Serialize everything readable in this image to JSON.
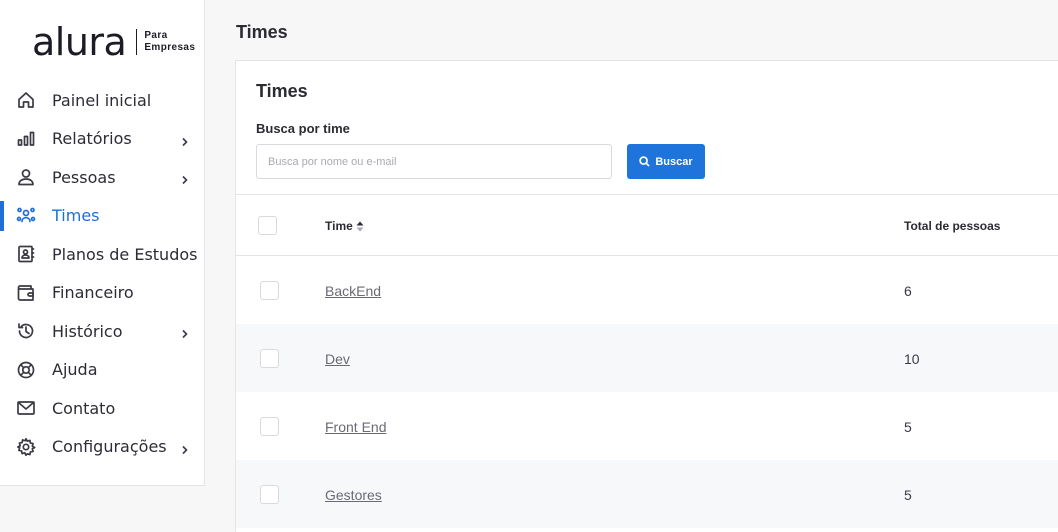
{
  "brand": {
    "logo_text": "alura",
    "sub_line1": "Para",
    "sub_line2": "Empresas"
  },
  "nav": [
    {
      "label": "Painel inicial",
      "icon": "home-icon",
      "chevron": false,
      "active": false
    },
    {
      "label": "Relatórios",
      "icon": "bar-chart-icon",
      "chevron": true,
      "active": false
    },
    {
      "label": "Pessoas",
      "icon": "person-icon",
      "chevron": true,
      "active": false
    },
    {
      "label": "Times",
      "icon": "team-icon",
      "chevron": false,
      "active": true
    },
    {
      "label": "Planos de Estudos",
      "icon": "study-plan-icon",
      "chevron": false,
      "active": false
    },
    {
      "label": "Financeiro",
      "icon": "wallet-icon",
      "chevron": false,
      "active": false
    },
    {
      "label": "Histórico",
      "icon": "history-icon",
      "chevron": true,
      "active": false
    },
    {
      "label": "Ajuda",
      "icon": "lifebuoy-icon",
      "chevron": false,
      "active": false
    },
    {
      "label": "Contato",
      "icon": "mail-icon",
      "chevron": false,
      "active": false
    },
    {
      "label": "Configurações",
      "icon": "gear-icon",
      "chevron": true,
      "active": false
    }
  ],
  "page": {
    "title": "Times"
  },
  "card": {
    "title": "Times",
    "search_label": "Busca por time",
    "search_placeholder": "Busca por nome ou e-mail",
    "search_value": "",
    "search_button": "Buscar"
  },
  "table": {
    "col_time": "Time",
    "col_total": "Total de pessoas",
    "rows": [
      {
        "name": "BackEnd",
        "total": "6"
      },
      {
        "name": "Dev",
        "total": "10"
      },
      {
        "name": "Front End",
        "total": "5"
      },
      {
        "name": "Gestores",
        "total": "5"
      }
    ]
  },
  "colors": {
    "accent": "#1f74dc",
    "active_nav": "#1f6fd6",
    "text": "#2b2b33",
    "background": "#f7f7f8"
  }
}
